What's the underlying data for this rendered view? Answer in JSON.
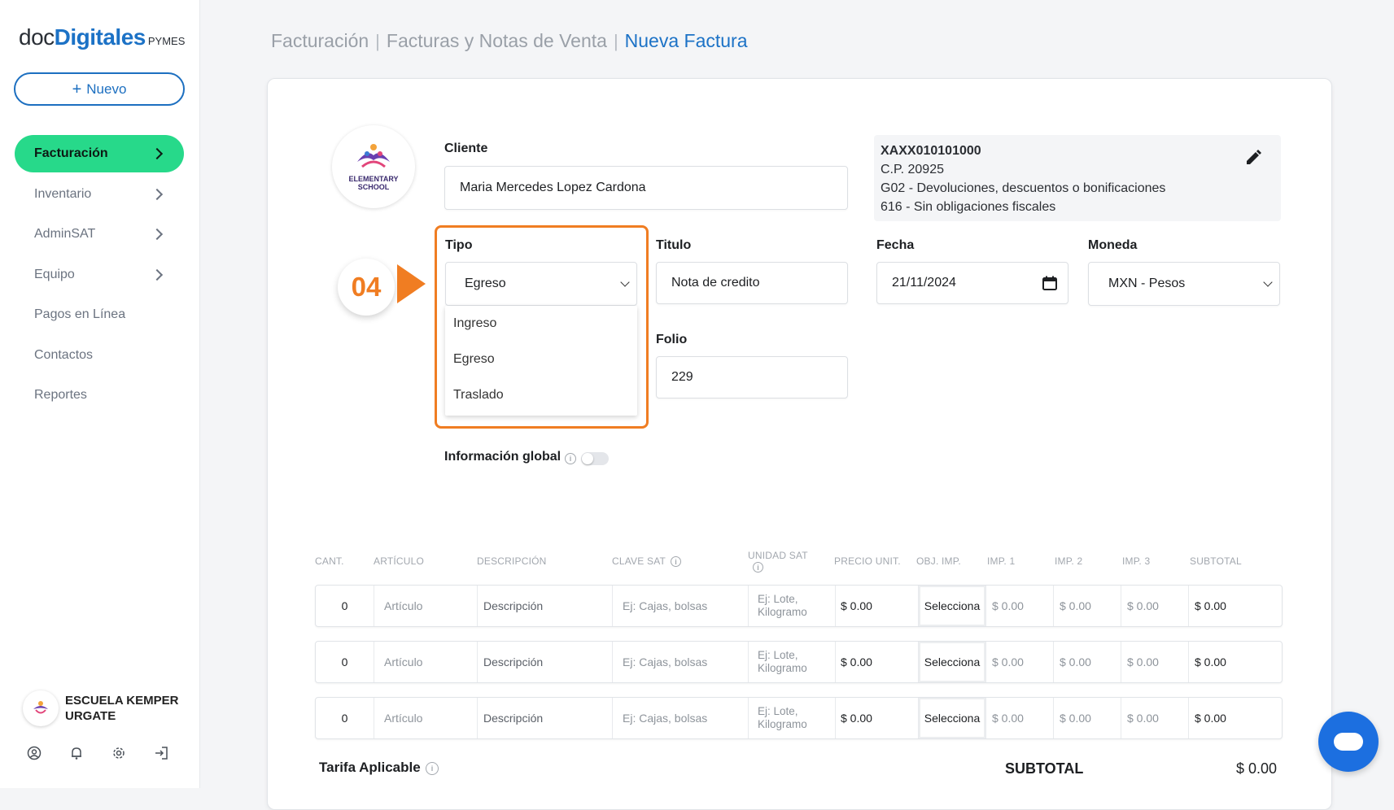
{
  "brand": {
    "part1": "doc",
    "part2": "Digitales",
    "part3": "PYMES"
  },
  "sidebar": {
    "new_button": "Nuevo",
    "items": [
      {
        "label": "Facturación",
        "chevron": true,
        "active": true
      },
      {
        "label": "Inventario",
        "chevron": true
      },
      {
        "label": "AdminSAT",
        "chevron": true
      },
      {
        "label": "Equipo",
        "chevron": true
      },
      {
        "label": "Pagos en Línea",
        "chevron": false
      },
      {
        "label": "Contactos",
        "chevron": false
      },
      {
        "label": "Reportes",
        "chevron": false
      }
    ],
    "user": {
      "name": "ESCUELA KEMPER URGATE"
    },
    "bottom_icons": [
      "user-circle-icon",
      "bell-icon",
      "gear-icon",
      "logout-icon"
    ]
  },
  "breadcrumb": {
    "level1": "Facturación",
    "level2": "Facturas y Notas de Venta",
    "current": "Nueva Factura"
  },
  "school_logo": {
    "line1": "ELEMENTARY",
    "line2": "SCHOOL"
  },
  "form": {
    "cliente_label": "Cliente",
    "cliente_value": "Maria Mercedes Lopez Cardona",
    "client_info": {
      "rfc": "XAXX010101000",
      "cp": "C.P. 20925",
      "uso": "G02 - Devoluciones, descuentos o bonificaciones",
      "regimen": "616 - Sin obligaciones fiscales"
    },
    "tipo_label": "Tipo",
    "tipo_value": "Egreso",
    "tipo_options": [
      "Ingreso",
      "Egreso",
      "Traslado"
    ],
    "titulo_label": "Titulo",
    "titulo_value": "Nota de credito",
    "folio_label": "Folio",
    "folio_value": "229",
    "fecha_label": "Fecha",
    "fecha_value": "21/11/2024",
    "moneda_label": "Moneda",
    "moneda_value": "MXN - Pesos",
    "info_global_label": "Información global"
  },
  "step_marker": "04",
  "table": {
    "headers": [
      "CANT.",
      "ARTÍCULO",
      "DESCRIPCIÓN",
      "CLAVE SAT",
      "UNIDAD SAT",
      "PRECIO UNIT.",
      "OBJ. IMP.",
      "IMP. 1",
      "IMP. 2",
      "IMP. 3",
      "SUBTOTAL"
    ],
    "rows": [
      {
        "cant": "0",
        "articulo": "Artículo",
        "descripcion": "Descripción",
        "clave": "Ej: Cajas, bolsas",
        "unidad1": "Ej: Lote,",
        "unidad2": "Kilogramo",
        "precio": "$ 0.00",
        "obj": "Selecciona",
        "imp1": "$ 0.00",
        "imp2": "$ 0.00",
        "imp3": "$ 0.00",
        "subtotal": "$ 0.00"
      },
      {
        "cant": "0",
        "articulo": "Artículo",
        "descripcion": "Descripción",
        "clave": "Ej: Cajas, bolsas",
        "unidad1": "Ej: Lote,",
        "unidad2": "Kilogramo",
        "precio": "$ 0.00",
        "obj": "Selecciona",
        "imp1": "$ 0.00",
        "imp2": "$ 0.00",
        "imp3": "$ 0.00",
        "subtotal": "$ 0.00"
      },
      {
        "cant": "0",
        "articulo": "Artículo",
        "descripcion": "Descripción",
        "clave": "Ej: Cajas, bolsas",
        "unidad1": "Ej: Lote,",
        "unidad2": "Kilogramo",
        "precio": "$ 0.00",
        "obj": "Selecciona",
        "imp1": "$ 0.00",
        "imp2": "$ 0.00",
        "imp3": "$ 0.00",
        "subtotal": "$ 0.00"
      }
    ]
  },
  "footer": {
    "tarifa_label": "Tarifa Aplicable",
    "subtotal_label": "SUBTOTAL",
    "subtotal_value": "$ 0.00"
  },
  "colors": {
    "accent": "#1c72c6",
    "active_nav": "#27d98a",
    "highlight": "#f07d22"
  }
}
